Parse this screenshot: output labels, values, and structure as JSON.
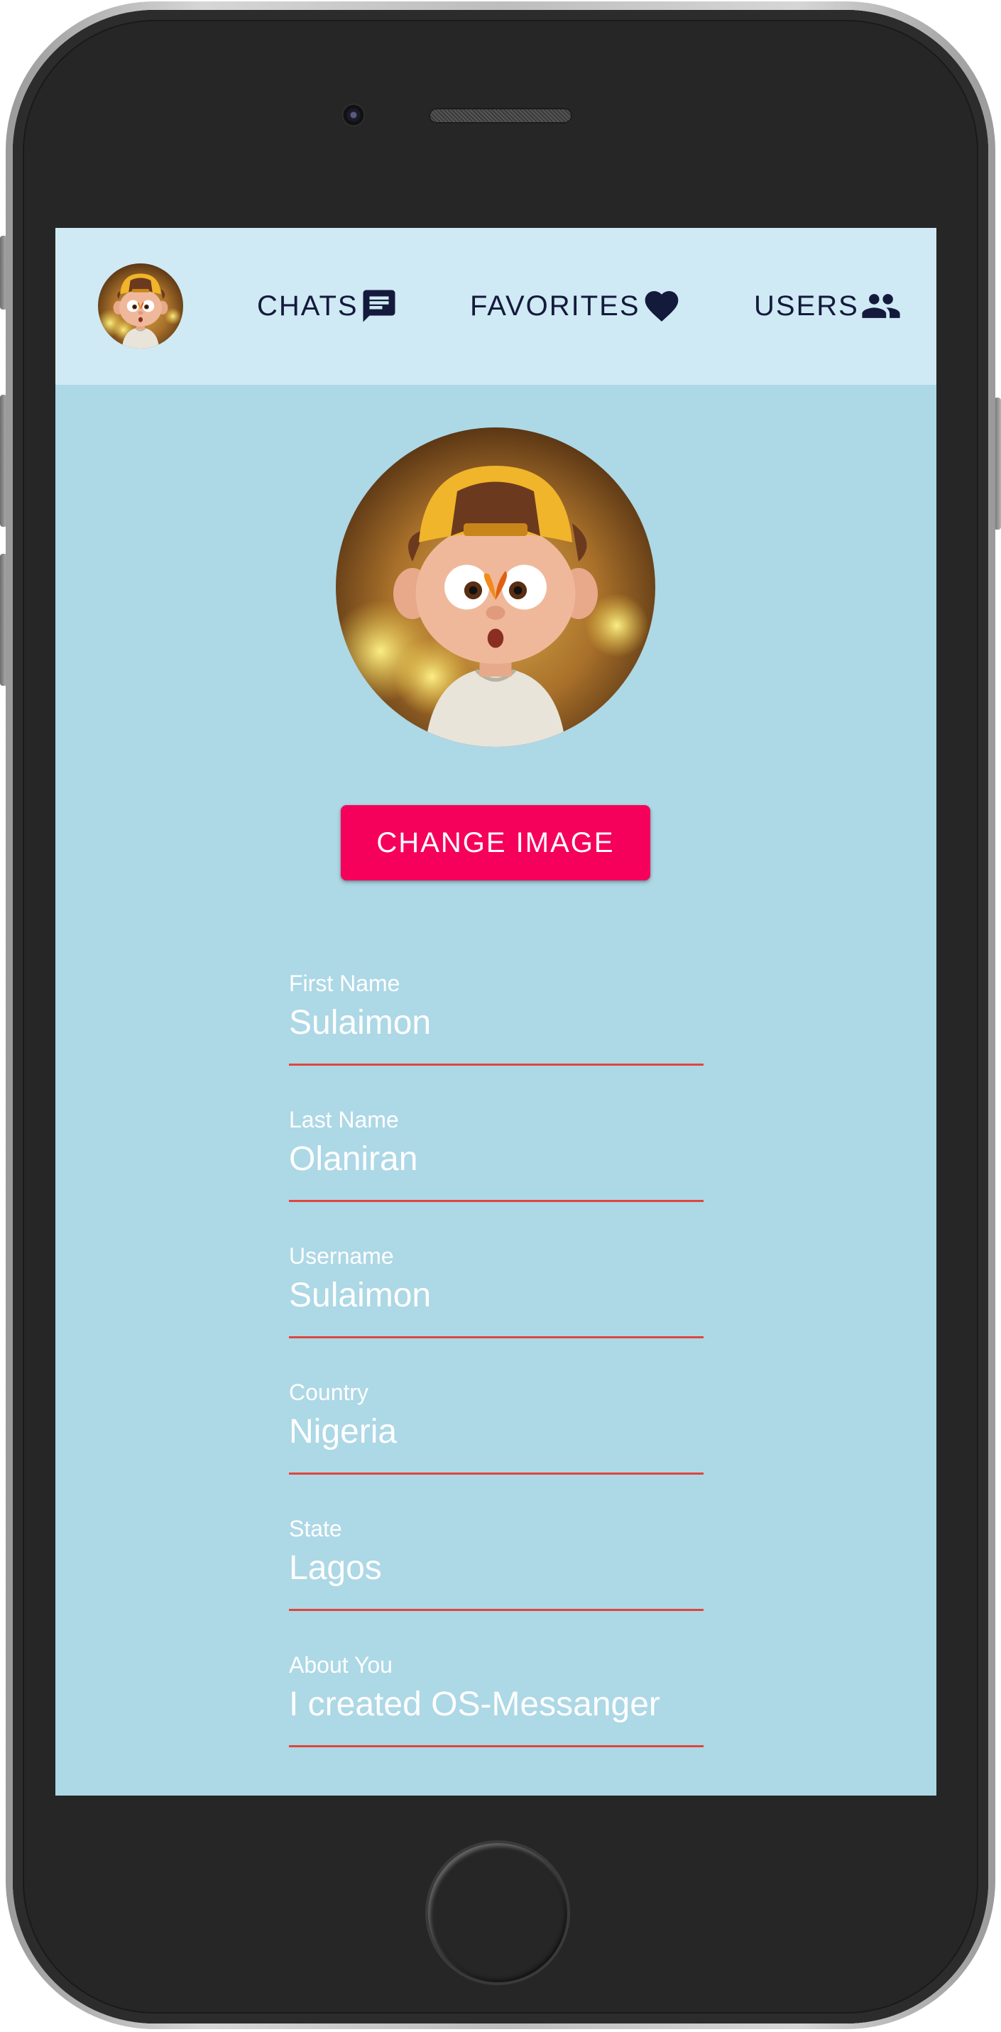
{
  "nav": {
    "chats_label": "CHATS",
    "favorites_label": "FAVORITES",
    "users_label": "USERS",
    "icons": [
      "chat-icon",
      "heart-icon",
      "people-icon"
    ]
  },
  "profile": {
    "change_image_label": "CHANGE IMAGE",
    "fields": [
      {
        "label": "First Name",
        "value": "Sulaimon"
      },
      {
        "label": "Last Name",
        "value": "Olaniran"
      },
      {
        "label": "Username",
        "value": "Sulaimon"
      },
      {
        "label": "Country",
        "value": "Nigeria"
      },
      {
        "label": "State",
        "value": "Lagos"
      },
      {
        "label": "About You",
        "value": "I created OS-Messanger"
      }
    ]
  },
  "colors": {
    "screen_bg": "#add8e6",
    "app_bar_bg": "#cfeaf4",
    "accent": "#f5005a",
    "underline": "#e0453c",
    "nav_text": "#141a3c"
  }
}
